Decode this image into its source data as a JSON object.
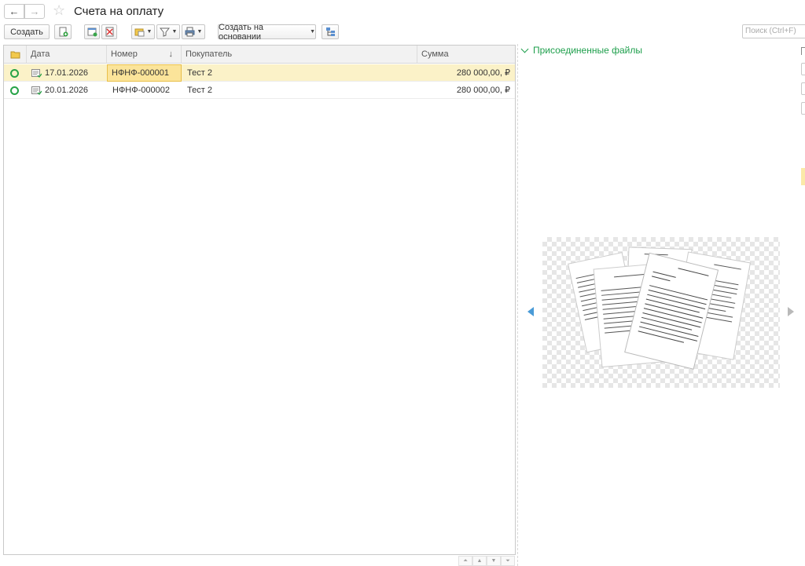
{
  "window": {
    "title": "Счета на оплату",
    "back_glyph": "←",
    "forward_glyph": "→",
    "favorite_glyph": "☆"
  },
  "toolbar": {
    "create_label": "Создать",
    "create_based_on_label": "Создать на основании",
    "search_placeholder": "Поиск (Ctrl+F)"
  },
  "table": {
    "columns": {
      "status": "",
      "date": "Дата",
      "number": "Номер",
      "sort_indicator": "↓",
      "buyer": "Покупатель",
      "amount": "Сумма"
    },
    "rows": [
      {
        "date": "17.01.2026",
        "number": "НФНФ-000001",
        "buyer": "Тест 2",
        "amount": "280 000,00, ₽",
        "selected": true
      },
      {
        "date": "20.01.2026",
        "number": "НФНФ-000002",
        "buyer": "Тест 2",
        "amount": "280 000,00, ₽",
        "selected": false
      }
    ]
  },
  "pager": {
    "first_glyph": "⏶",
    "prev_glyph": "▲",
    "next_glyph": "▼",
    "last_glyph": "⏷"
  },
  "attached_files": {
    "title": "Присоединенные файлы"
  },
  "colors": {
    "accent_green": "#1e9f4c",
    "selection": "#fbf2c8",
    "focus_cell": "#fbe49a"
  }
}
